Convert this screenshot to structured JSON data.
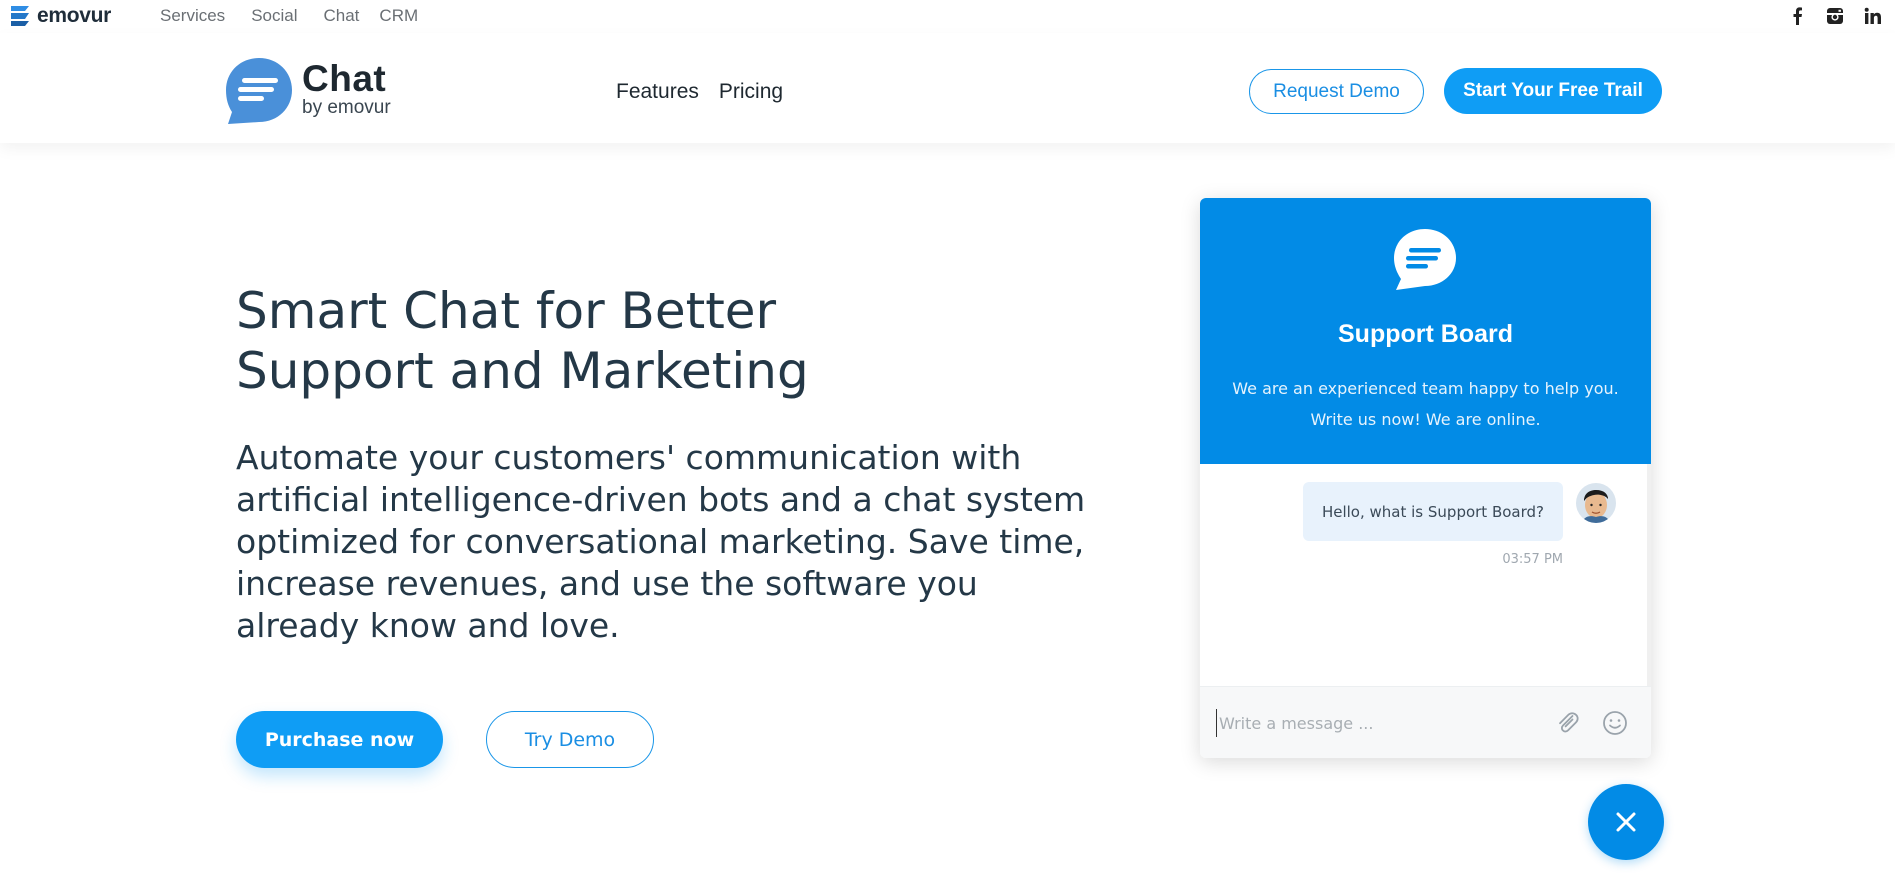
{
  "topbar": {
    "logo_text": "emovur",
    "nav": [
      "Services",
      "Social",
      "Chat",
      "CRM"
    ],
    "social": [
      "facebook-icon",
      "instagram-icon",
      "linkedin-icon"
    ]
  },
  "header": {
    "brand_title": "Chat",
    "brand_sub": "by emovur",
    "nav": [
      "Features",
      "Pricing"
    ],
    "request_demo": "Request Demo",
    "free_trial": "Start Your Free Trail"
  },
  "hero": {
    "title_line1": "Smart Chat for Better",
    "title_line2": "Support and Marketing",
    "description": "Automate your customers' communication with artificial intelligence-driven bots and a chat system optimized for conversational marketing. Save time, increase revenues, and use the software you already know and love.",
    "purchase": "Purchase now",
    "try_demo": "Try Demo"
  },
  "chat": {
    "title": "Support Board",
    "desc_line1": "We are an experienced team happy to help you.",
    "desc_line2": "Write us now! We are online.",
    "message": "Hello, what is Support Board?",
    "time": "03:57 PM",
    "input_placeholder": "Write a message ..."
  },
  "colors": {
    "accent": "#0f9df5",
    "chat_header": "#028be6",
    "text_dark": "#243847"
  }
}
